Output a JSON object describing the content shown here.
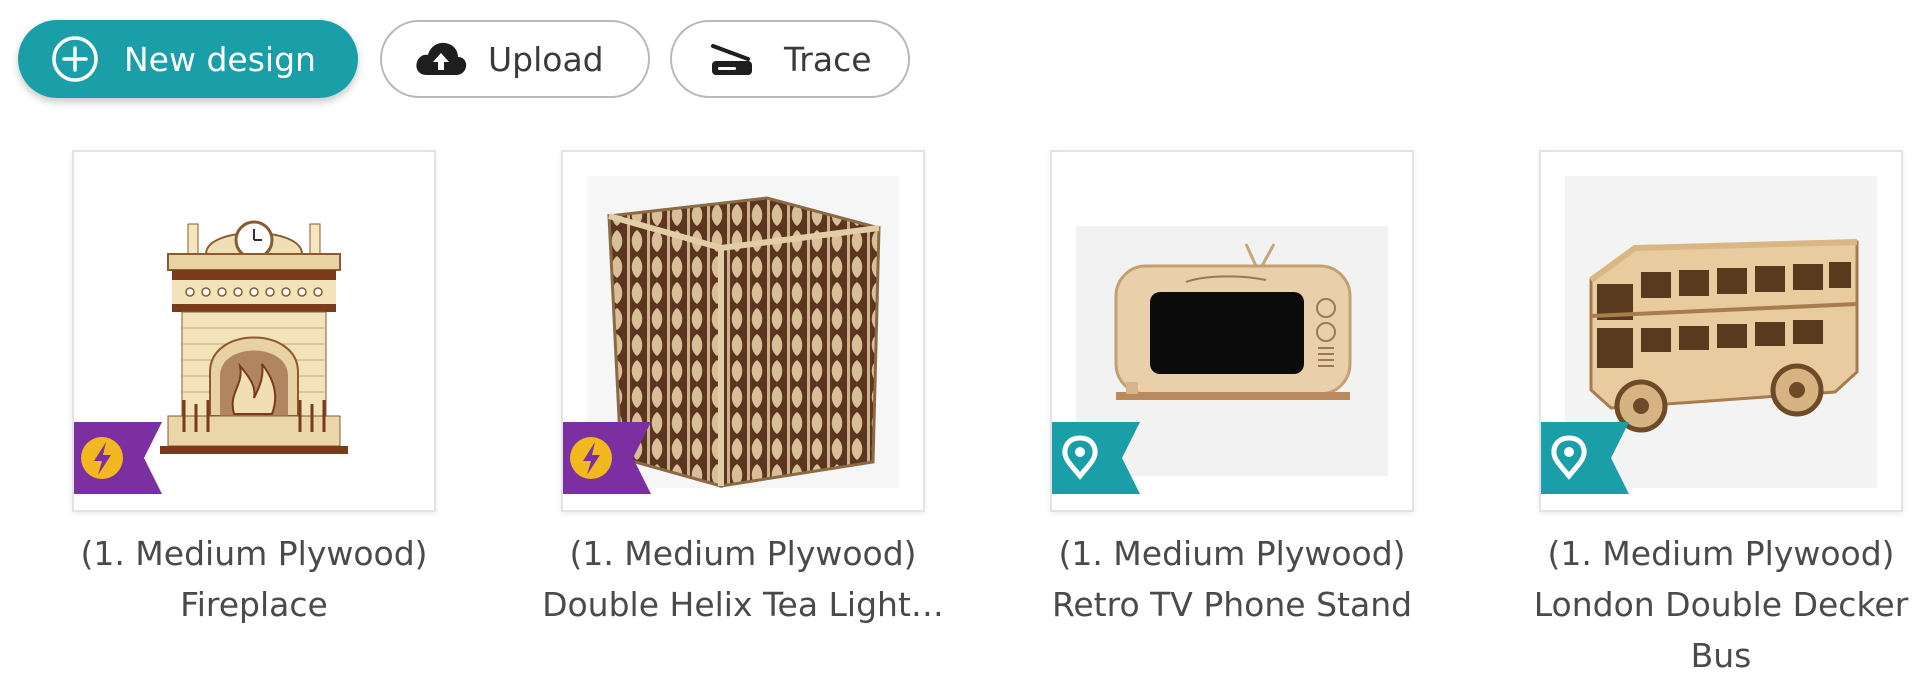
{
  "toolbar": {
    "new_design_label": "New design",
    "upload_label": "Upload",
    "trace_label": "Trace",
    "primary_color": "#1a9fa9"
  },
  "designs": [
    {
      "title": "(1. Medium Plywood) Fireplace",
      "badge": "lightning-icon",
      "badge_color": "#7b2fa0"
    },
    {
      "title": "(1. Medium Plywood) Double Helix Tea Light…",
      "badge": "lightning-icon",
      "badge_color": "#7b2fa0"
    },
    {
      "title": "(1. Medium Plywood) Retro TV Phone Stand",
      "badge": "tag-icon",
      "badge_color": "#1a9fa9"
    },
    {
      "title": "(1. Medium Plywood) London Double Decker Bus",
      "badge": "tag-icon",
      "badge_color": "#1a9fa9"
    }
  ]
}
